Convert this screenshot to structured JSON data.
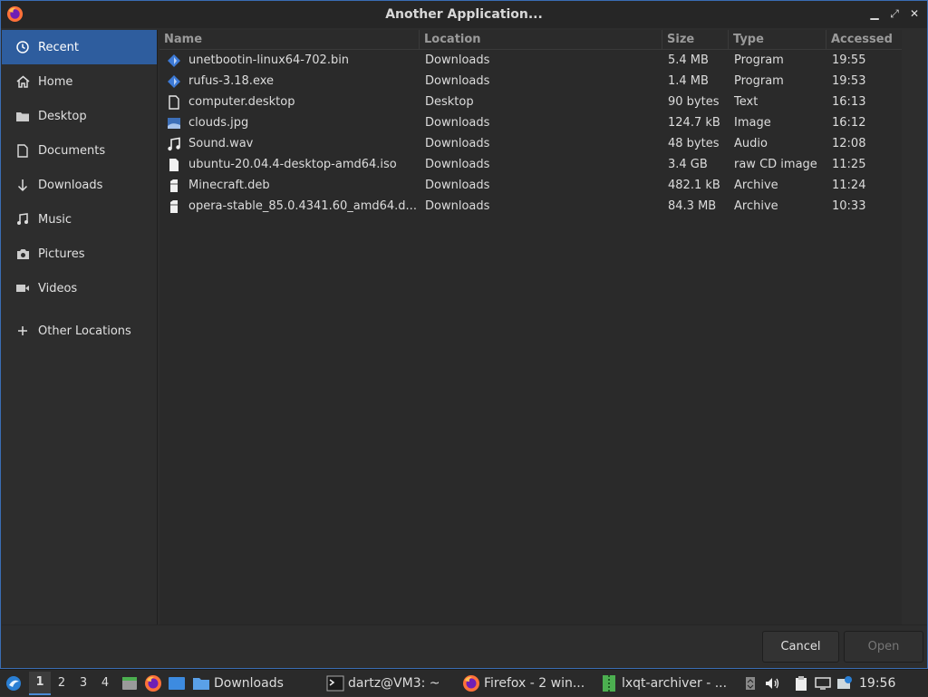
{
  "window": {
    "title": "Another Application...",
    "controls": {
      "minimize": "▁",
      "restore": "⤢",
      "close": "✕"
    }
  },
  "sidebar": {
    "items": [
      {
        "label": "Recent",
        "icon": "clock-icon",
        "active": true
      },
      {
        "label": "Home",
        "icon": "home-icon"
      },
      {
        "label": "Desktop",
        "icon": "folder-icon"
      },
      {
        "label": "Documents",
        "icon": "document-icon"
      },
      {
        "label": "Downloads",
        "icon": "download-icon"
      },
      {
        "label": "Music",
        "icon": "music-icon"
      },
      {
        "label": "Pictures",
        "icon": "camera-icon"
      },
      {
        "label": "Videos",
        "icon": "video-icon"
      }
    ],
    "other": {
      "label": "Other Locations",
      "icon": "plus-icon"
    }
  },
  "table": {
    "headers": {
      "name": "Name",
      "location": "Location",
      "size": "Size",
      "type": "Type",
      "accessed": "Accessed"
    },
    "rows": [
      {
        "name": "unetbootin-linux64-702.bin",
        "location": "Downloads",
        "size": "5.4 MB",
        "type": "Program",
        "accessed": "19:55",
        "icon": "program-icon"
      },
      {
        "name": "rufus-3.18.exe",
        "location": "Downloads",
        "size": "1.4 MB",
        "type": "Program",
        "accessed": "19:53",
        "icon": "program-icon"
      },
      {
        "name": "computer.desktop",
        "location": "Desktop",
        "size": "90 bytes",
        "type": "Text",
        "accessed": "16:13",
        "icon": "text-file-icon"
      },
      {
        "name": "clouds.jpg",
        "location": "Downloads",
        "size": "124.7 kB",
        "type": "Image",
        "accessed": "16:12",
        "icon": "image-icon"
      },
      {
        "name": "Sound.wav",
        "location": "Downloads",
        "size": "48 bytes",
        "type": "Audio",
        "accessed": "12:08",
        "icon": "audio-icon"
      },
      {
        "name": "ubuntu-20.04.4-desktop-amd64.iso",
        "location": "Downloads",
        "size": "3.4 GB",
        "type": "raw CD image",
        "accessed": "11:25",
        "icon": "disc-image-icon"
      },
      {
        "name": "Minecraft.deb",
        "location": "Downloads",
        "size": "482.1 kB",
        "type": "Archive",
        "accessed": "11:24",
        "icon": "archive-icon"
      },
      {
        "name": "opera-stable_85.0.4341.60_amd64.d...",
        "location": "Downloads",
        "size": "84.3 MB",
        "type": "Archive",
        "accessed": "10:33",
        "icon": "archive-icon"
      }
    ]
  },
  "footer": {
    "cancel": "Cancel",
    "open": "Open"
  },
  "taskbar": {
    "desktops": [
      "1",
      "2",
      "3",
      "4"
    ],
    "active_desktop": "1",
    "tasks": [
      {
        "label": "Downloads",
        "icon": "folder-icon"
      },
      {
        "label": "dartz@VM3: ~",
        "icon": "terminal-icon"
      },
      {
        "label": "Firefox - 2 win...",
        "icon": "firefox-icon"
      },
      {
        "label": "lxqt-archiver - ...",
        "icon": "archiver-icon"
      }
    ],
    "clock": "19:56"
  },
  "colors": {
    "accent": "#2e5d9e",
    "window_border": "#3a6db4",
    "background": "#2d2d2d"
  }
}
